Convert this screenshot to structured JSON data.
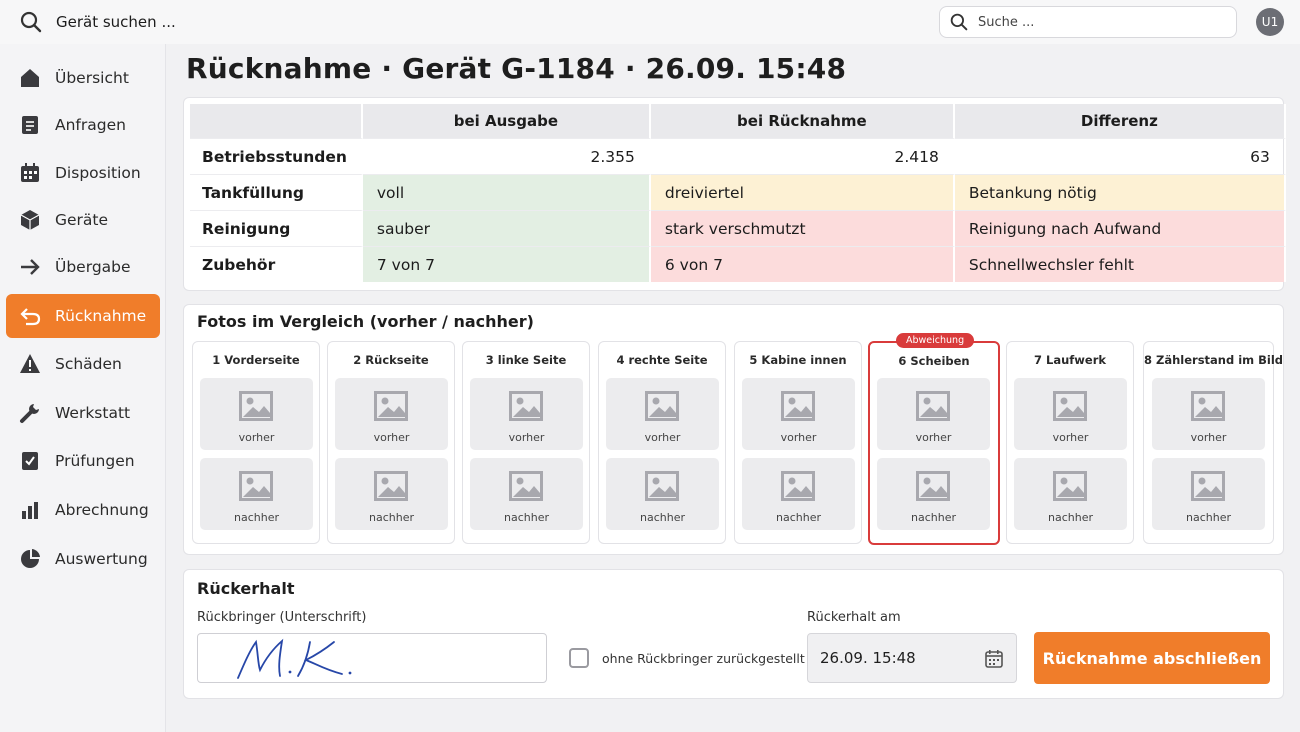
{
  "topbar": {
    "device_search_label": "Gerät suchen ...",
    "search_placeholder": "Suche ...",
    "avatar_initials": "U1"
  },
  "sidebar": {
    "items": [
      {
        "label": "Übersicht",
        "icon": "home-icon"
      },
      {
        "label": "Anfragen",
        "icon": "document-icon"
      },
      {
        "label": "Disposition",
        "icon": "calendar-icon"
      },
      {
        "label": "Geräte",
        "icon": "box-icon"
      },
      {
        "label": "Übergabe",
        "icon": "arrow-right-icon"
      },
      {
        "label": "Rücknahme",
        "icon": "return-arrow-icon",
        "active": true
      },
      {
        "label": "Schäden",
        "icon": "warning-icon"
      },
      {
        "label": "Werkstatt",
        "icon": "wrench-icon"
      },
      {
        "label": "Prüfungen",
        "icon": "checklist-icon"
      },
      {
        "label": "Abrechnung",
        "icon": "bar-chart-icon"
      },
      {
        "label": "Auswertung",
        "icon": "pie-chart-icon"
      }
    ]
  },
  "page": {
    "title": "Rücknahme · Gerät G-1184 · 26.09. 15:48"
  },
  "comparison": {
    "headers": [
      "",
      "bei Ausgabe",
      "bei Rücknahme",
      "Differenz"
    ],
    "rows": [
      {
        "label": "Betriebsstunden",
        "ausgabe": "2.355",
        "ruecknahme": "2.418",
        "differenz": "63",
        "status": "none"
      },
      {
        "label": "Tankfüllung",
        "ausgabe": "voll",
        "ruecknahme": "dreiviertel",
        "differenz": "Betankung nötig",
        "status": "warning"
      },
      {
        "label": "Reinigung",
        "ausgabe": "sauber",
        "ruecknahme": "stark verschmutzt",
        "differenz": "Reinigung nach Aufwand",
        "status": "error"
      },
      {
        "label": "Zubehör",
        "ausgabe": "7 von 7",
        "ruecknahme": "6 von 7",
        "differenz": "Schnellwechsler fehlt",
        "status": "error"
      }
    ]
  },
  "photos": {
    "title": "Fotos im Vergleich (vorher / nachher)",
    "before_label": "vorher",
    "after_label": "nachher",
    "flag_label": "Abweichung",
    "columns": [
      {
        "title": "1 Vorderseite",
        "flagged": false
      },
      {
        "title": "2 Rückseite",
        "flagged": false
      },
      {
        "title": "3 linke Seite",
        "flagged": false
      },
      {
        "title": "4 rechte Seite",
        "flagged": false
      },
      {
        "title": "5 Kabine innen",
        "flagged": false
      },
      {
        "title": "6 Scheiben",
        "flagged": true
      },
      {
        "title": "7 Laufwerk",
        "flagged": false
      },
      {
        "title": "8 Zählerstand im Bild",
        "flagged": false
      }
    ]
  },
  "return_section": {
    "title": "Rückerhalt",
    "signature_label": "Rückbringer (Unterschrift)",
    "no_returner_label": "ohne Rückbringer zurückgestellt",
    "no_returner_checked": false,
    "date_label": "Rückerhalt am",
    "date_value": "26.09. 15:48",
    "submit_label": "Rücknahme abschließen"
  },
  "colors": {
    "accent": "#f07d2a",
    "ok": "#e3efe3",
    "warning": "#fdf1d4",
    "error": "#fcdcdc",
    "flag": "#d93b3b"
  }
}
